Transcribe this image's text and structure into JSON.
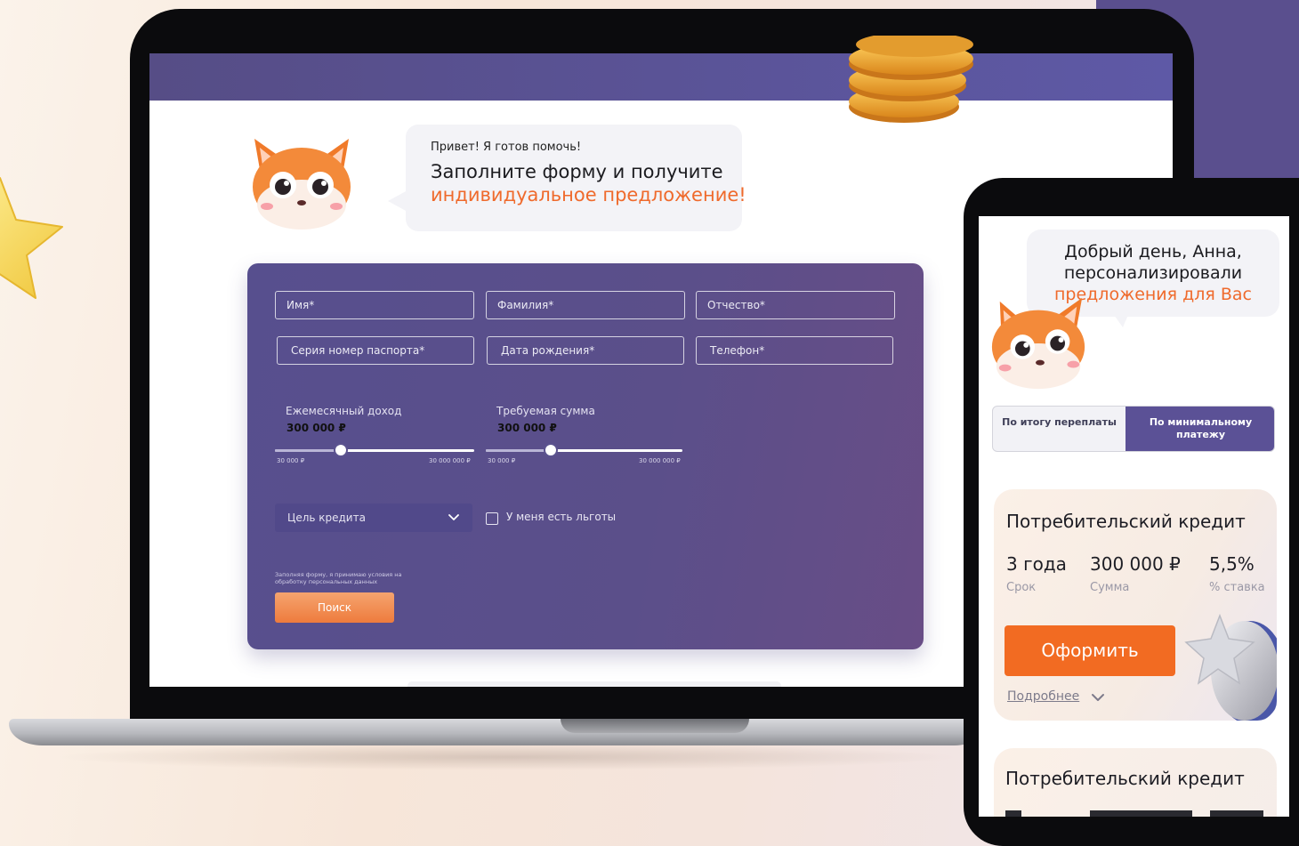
{
  "laptop": {
    "bubble": {
      "small": "Привет! Я готов помочь!",
      "main": "Заполните форму и получите",
      "accent": "индивидуальное предложение!"
    },
    "form": {
      "first_name_placeholder": "Имя*",
      "last_name_placeholder": "Фамилия*",
      "middle_name_placeholder": "Отчество*",
      "passport_placeholder": "Серия номер паспорта*",
      "birthdate_placeholder": "Дата рождения*",
      "phone_placeholder": "Телефон*",
      "income": {
        "label": "Ежемесячный доход",
        "value": "300 000 ₽",
        "min": "30 000 ₽",
        "max": "30 000 000 ₽",
        "level": 0.33
      },
      "amount": {
        "label": "Требуемая сумма",
        "value": "300 000 ₽",
        "min": "30 000 ₽",
        "max": "30 000 000 ₽",
        "level": 0.33
      },
      "purpose_label": "Цель кредита",
      "benefits_label": "У меня есть льготы",
      "consent": "Заполняя форму, я принимаю условия на обработку персональных данных",
      "search_label": "Поиск"
    }
  },
  "phone": {
    "greeting": {
      "line1": "Добрый день, Анна,",
      "line2": "персонализировали",
      "line3": "предложения для Вас"
    },
    "tabs": [
      {
        "label": "По итогу переплаты",
        "active": false
      },
      {
        "label": "По минимальному платежу",
        "active": true
      }
    ],
    "card": {
      "title": "Потребительский кредит",
      "term_value": "3 года",
      "term_caption": "Срок",
      "sum_value": "300 000 ₽",
      "sum_caption": "Сумма",
      "rate_value": "5,5%",
      "rate_caption": "% ставка",
      "apply_label": "Оформить",
      "more_label": "Подробнее"
    },
    "card2": {
      "title": "Потребительский кредит"
    }
  },
  "colors": {
    "accent": "#ef6a2c",
    "brand_purple": "#5b5196",
    "button_orange": "#f26b22"
  },
  "icons": [
    "fox-mascot-icon",
    "chevron-down-icon",
    "star-icon",
    "coins-icon",
    "medal-icon"
  ]
}
